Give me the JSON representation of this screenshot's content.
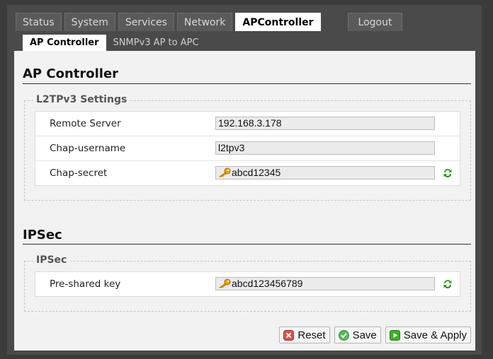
{
  "tabs": [
    {
      "label": "Status"
    },
    {
      "label": "System"
    },
    {
      "label": "Services"
    },
    {
      "label": "Network"
    },
    {
      "label": "APController"
    },
    {
      "label": "Logout"
    }
  ],
  "active_tab": "APController",
  "subtabs": [
    {
      "label": "AP Controller"
    },
    {
      "label": "SNMPv3 AP to APC"
    }
  ],
  "ap_controller": {
    "title": "AP Controller",
    "legend": "L2TPv3 Settings",
    "remote_server": {
      "label": "Remote Server",
      "value": "192.168.3.178"
    },
    "chap_username": {
      "label": "Chap-username",
      "value": "l2tpv3"
    },
    "chap_secret": {
      "label": "Chap-secret",
      "value": "abcd12345"
    }
  },
  "ipsec": {
    "title": "IPSec",
    "legend": "IPSec",
    "psk": {
      "label": "Pre-shared key",
      "value": "abcd123456789"
    }
  },
  "buttons": {
    "reset": "Reset",
    "save": "Save",
    "save_apply": "Save & Apply"
  },
  "icons": {
    "key": "key-icon",
    "refresh": "refresh-icon",
    "reset": "reset-icon",
    "save": "save-icon",
    "apply": "apply-icon"
  },
  "colors": {
    "reset_icon": "#d9534f",
    "save_icon": "#5cb85c",
    "apply_icon": "#3fae2a",
    "key_icon": "#e3a21a"
  }
}
